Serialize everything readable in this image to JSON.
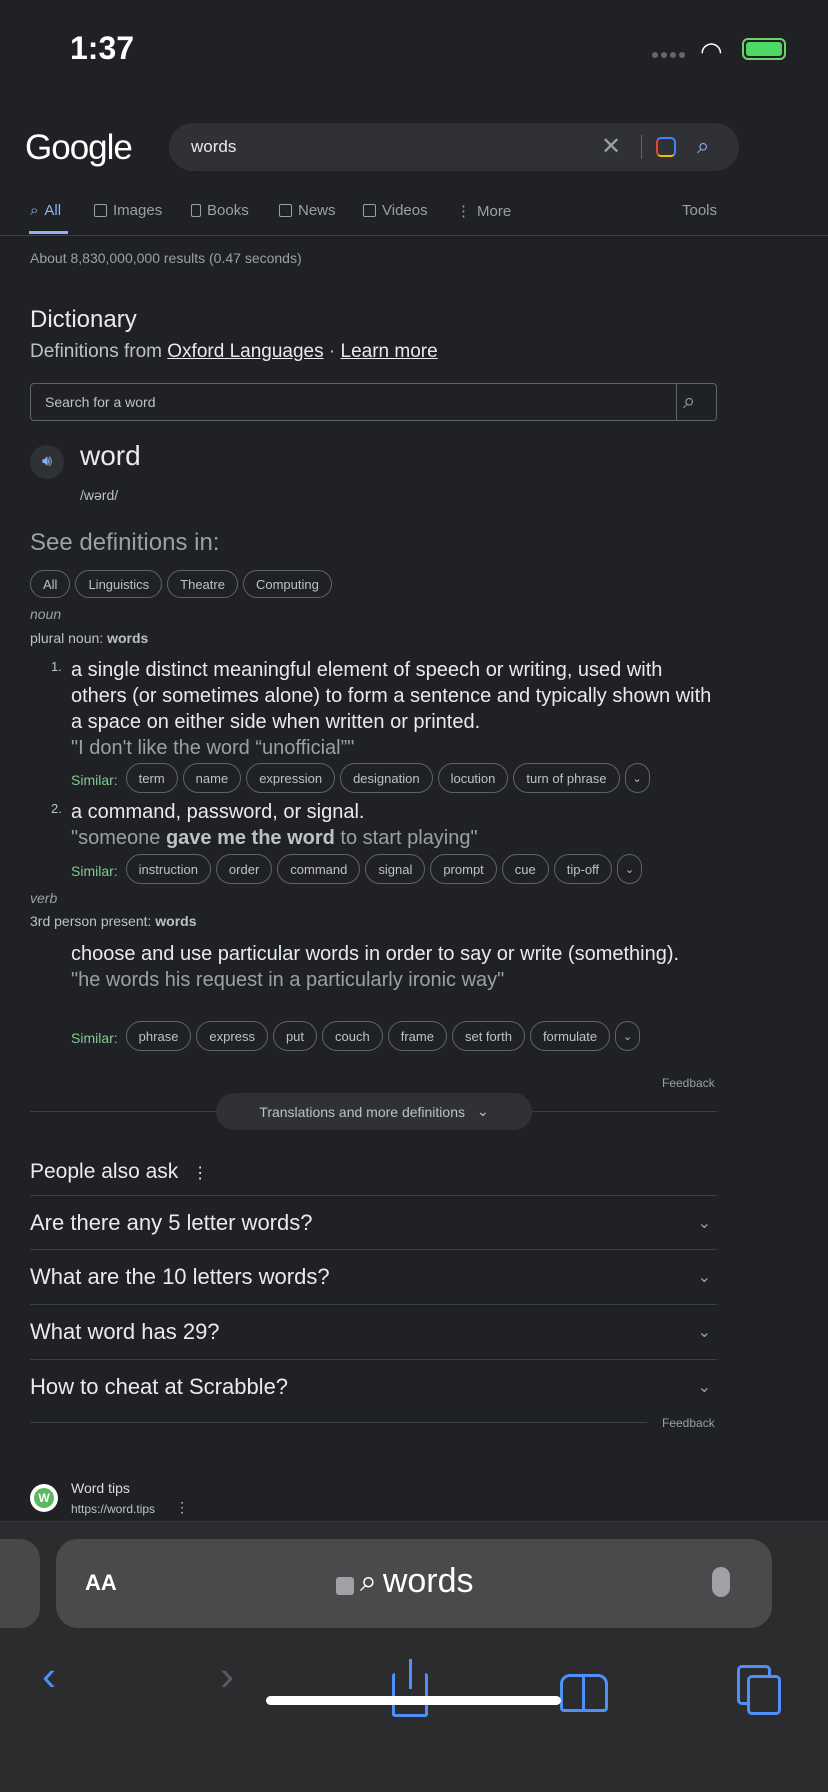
{
  "status": {
    "time": "1:37"
  },
  "header": {
    "logo": "Google",
    "query": "words"
  },
  "tabs": [
    {
      "label": "All",
      "icon": "search-icon"
    },
    {
      "label": "Images",
      "icon": "image-icon"
    },
    {
      "label": "Books",
      "icon": "book-icon"
    },
    {
      "label": "News",
      "icon": "news-icon"
    },
    {
      "label": "Videos",
      "icon": "video-icon"
    },
    {
      "label": "More",
      "icon": "more-vert-icon"
    }
  ],
  "tools": "Tools",
  "result_stats": "About 8,830,000,000 results (0.47 seconds)",
  "dictionary": {
    "title": "Dictionary",
    "from": "Definitions from ",
    "oxford": "Oxford Languages",
    "dot": " · ",
    "learn": "Learn more",
    "search_placeholder": "Search for a word",
    "word": "word",
    "pron": "/wərd/",
    "see_in": "See definitions in:",
    "filters": [
      "All",
      "Linguistics",
      "Theatre",
      "Computing"
    ],
    "noun": "noun",
    "plural_label": "plural noun: ",
    "plural": "words",
    "similar_label": "Similar:",
    "defs": [
      {
        "num": "1.",
        "text": "a single distinct meaningful element of speech or writing, used with others (or sometimes alone) to form a sentence and typically shown with a space on either side when written or printed.",
        "example": "\"I don't like the word “unofficial”\"",
        "similar": [
          "term",
          "name",
          "expression",
          "designation",
          "locution",
          "turn of phrase"
        ]
      },
      {
        "num": "2.",
        "text": "a command, password, or signal.",
        "ex_pre": "\"someone ",
        "ex_bold": "gave me the word",
        "ex_post": " to start playing\"",
        "similar": [
          "instruction",
          "order",
          "command",
          "signal",
          "prompt",
          "cue",
          "tip-off"
        ]
      }
    ],
    "verb": "verb",
    "third_label": "3rd person present: ",
    "third": "words",
    "verb_def": {
      "text": "choose and use particular words in order to say or write (something).",
      "example": "\"he words his request in a particularly ironic way\"",
      "similar": [
        "phrase",
        "express",
        "put",
        "couch",
        "frame",
        "set forth",
        "formulate"
      ]
    },
    "feedback": "Feedback",
    "translations": "Translations and more definitions"
  },
  "paa": {
    "title": "People also ask",
    "questions": [
      "Are there any 5 letter words?",
      "What are the 10 letters words?",
      "What word has 29?",
      "How to cheat at Scrabble?"
    ],
    "feedback": "Feedback"
  },
  "result": {
    "favicon": "W",
    "site": "Word tips",
    "url": "https://word.tips"
  },
  "safari": {
    "aa": "AA",
    "url": "words"
  }
}
